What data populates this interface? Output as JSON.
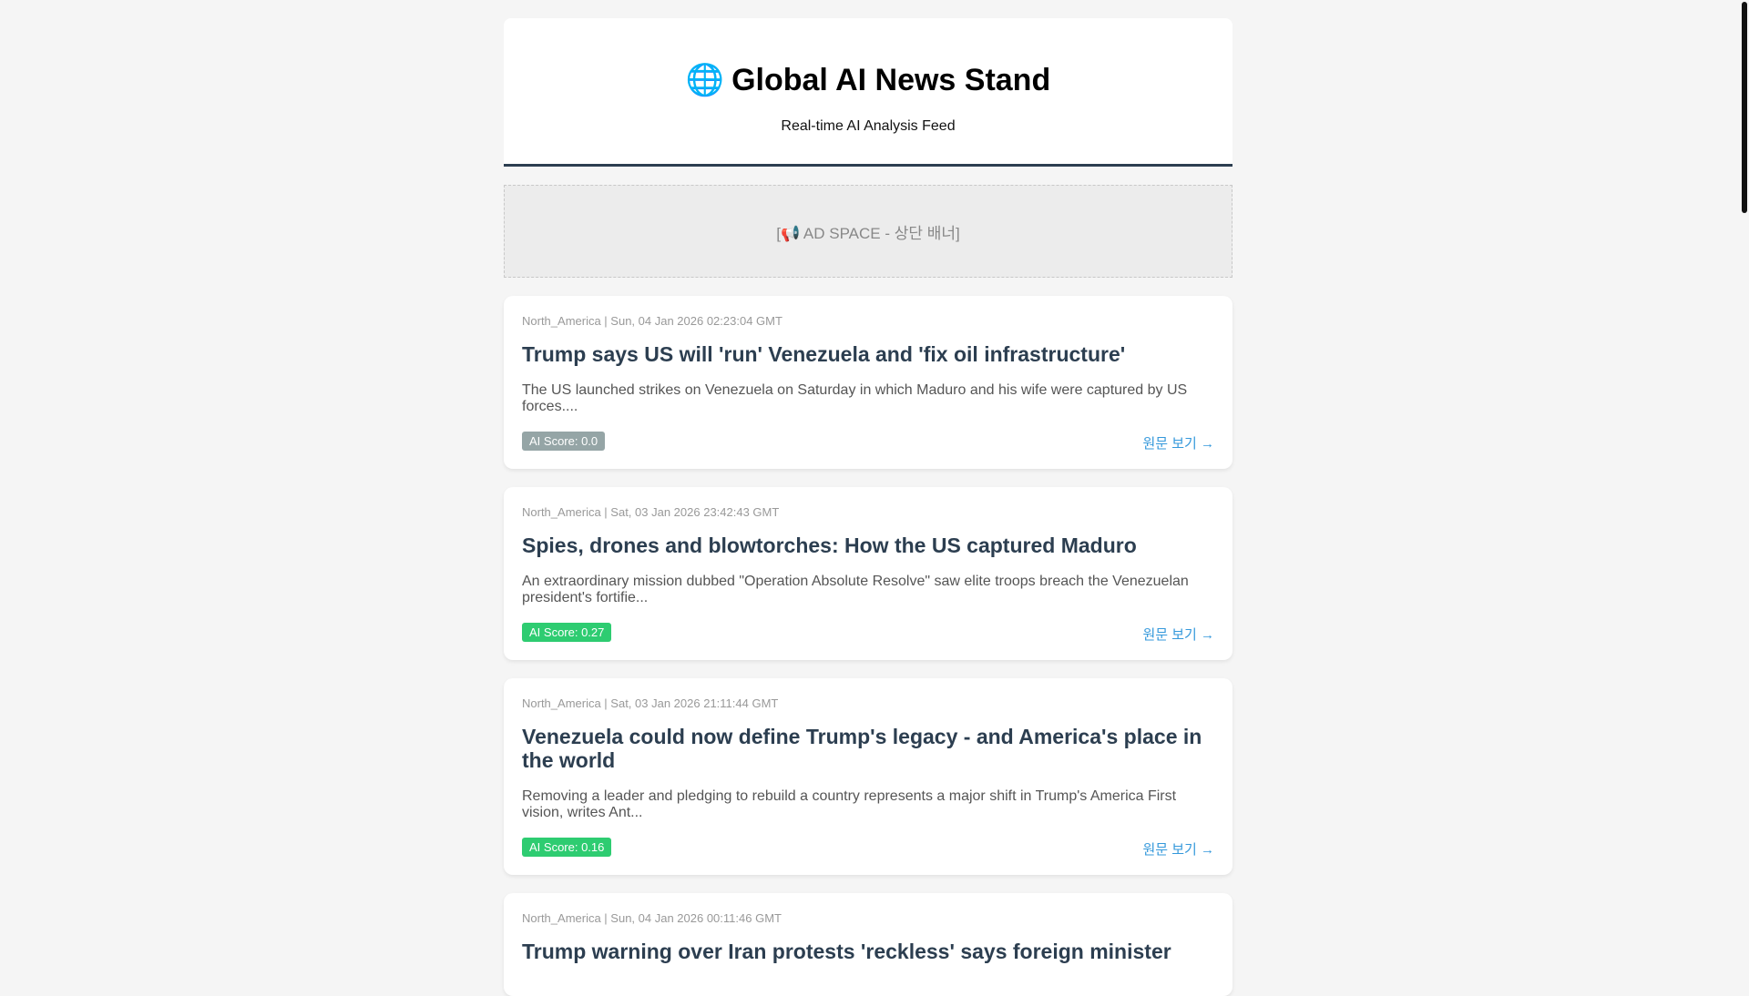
{
  "header": {
    "icon": "globe-icon",
    "title": "Global AI News Stand",
    "subtitle": "Real-time AI Analysis Feed"
  },
  "ad": {
    "label": "[📢 AD SPACE - 상단 배너]"
  },
  "articles": [
    {
      "meta": "North_America | Sun, 04 Jan 2026 02:23:04 GMT",
      "title": "Trump says US will 'run' Venezuela and 'fix oil infrastructure'",
      "desc": "The US launched strikes on Venezuela on Saturday in which Maduro and his wife were captured by US forces....",
      "score": "AI Score: 0.0",
      "score_color": "#95a5a6",
      "link": "원문 보기 →"
    },
    {
      "meta": "North_America | Sat, 03 Jan 2026 23:42:43 GMT",
      "title": "Spies, drones and blowtorches: How the US captured Maduro",
      "desc": "An extraordinary mission dubbed \"Operation Absolute Resolve\" saw elite troops breach the Venezuelan president's fortifie...",
      "score": "AI Score: 0.27",
      "score_color": "#2ecc71",
      "link": "원문 보기 →"
    },
    {
      "meta": "North_America | Sat, 03 Jan 2026 21:11:44 GMT",
      "title": "Venezuela could now define Trump's legacy - and America's place in the world",
      "desc": "Removing a leader and pledging to rebuild a country represents a major shift in Trump's America First vision, writes Ant...",
      "score": "AI Score: 0.16",
      "score_color": "#2ecc71",
      "link": "원문 보기 →"
    },
    {
      "meta": "North_America | Sun, 04 Jan 2026 00:11:46 GMT",
      "title": "Trump warning over Iran protests 'reckless' says foreign minister"
    }
  ]
}
